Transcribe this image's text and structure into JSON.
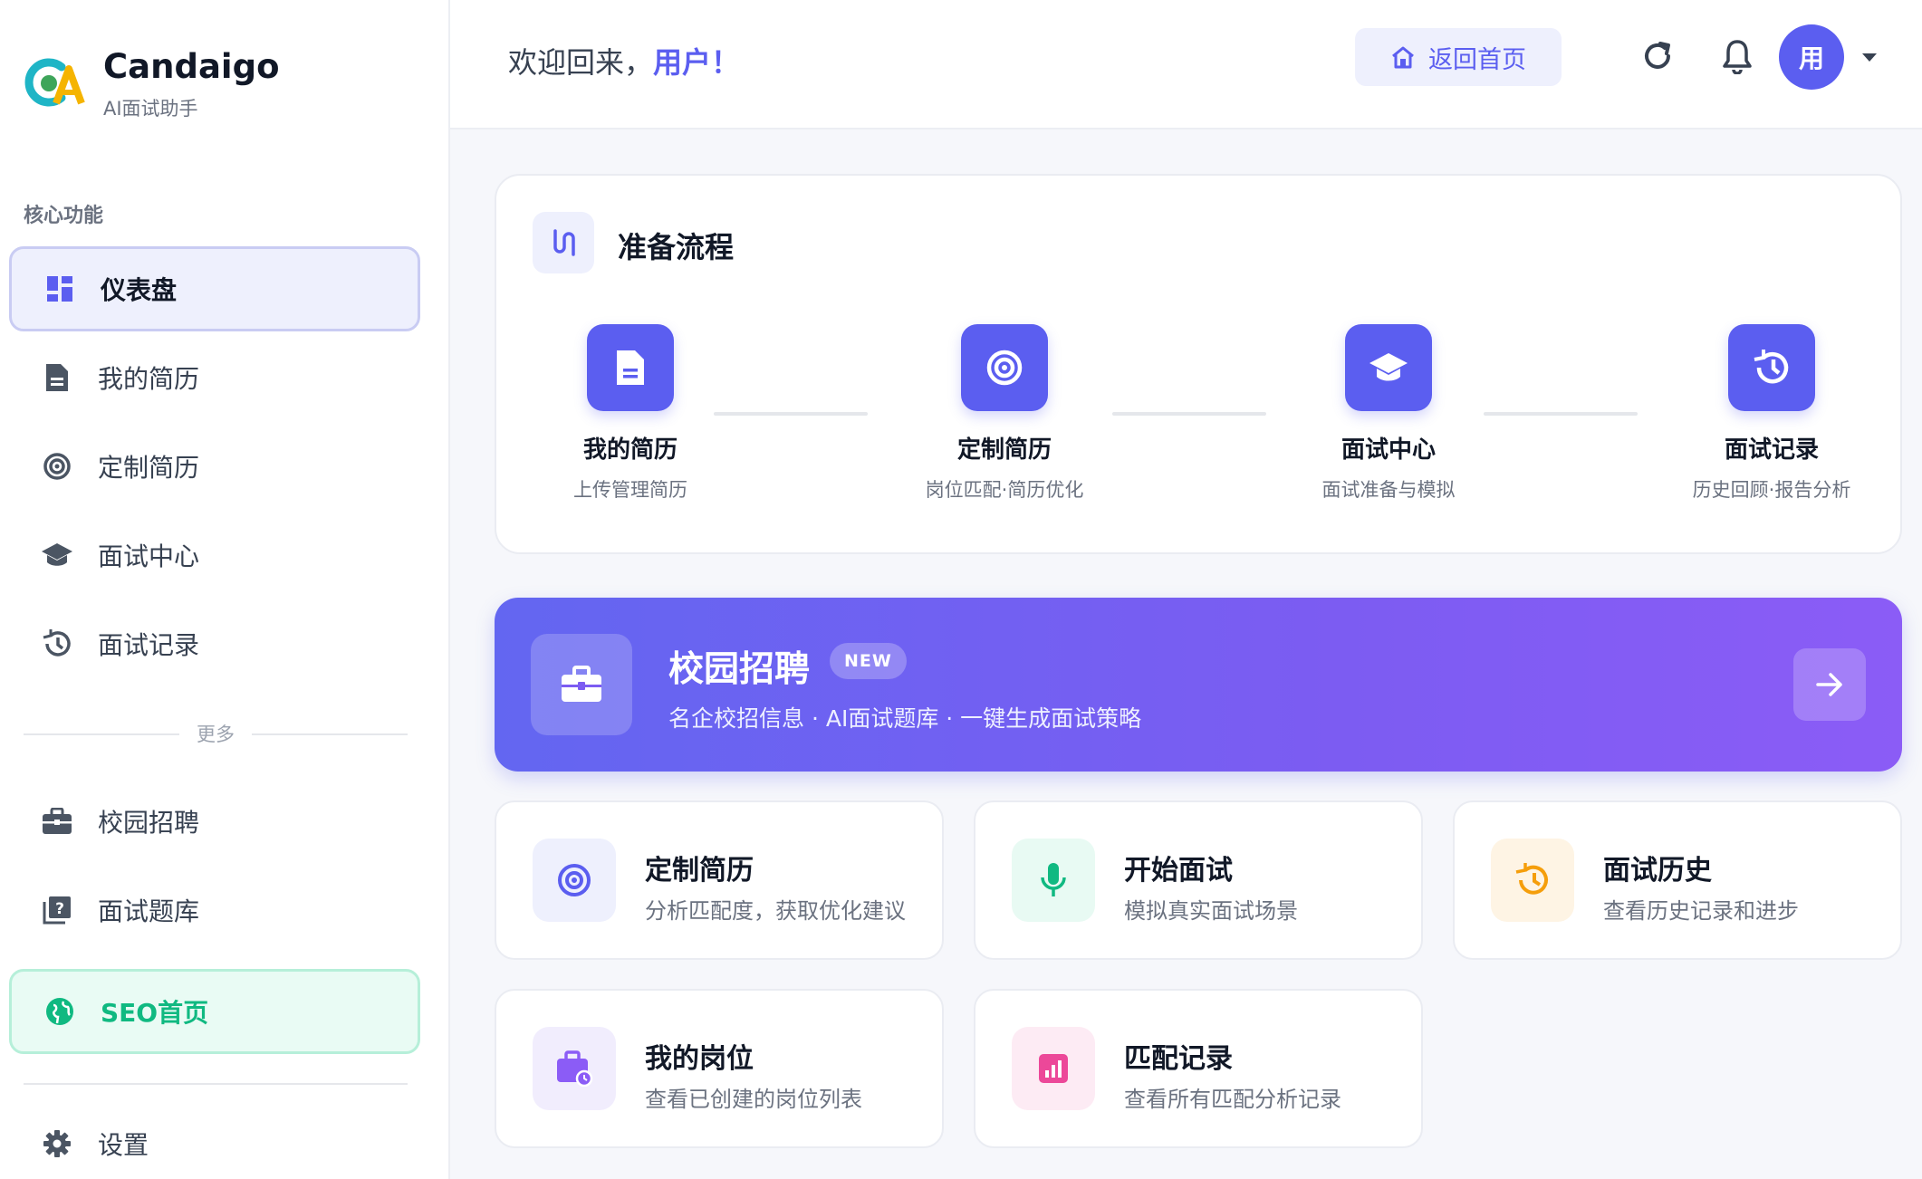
{
  "brand": {
    "name": "Candaigo",
    "subtitle": "AI面试助手"
  },
  "sidebar": {
    "section_core": "核心功能",
    "items": [
      {
        "label": "仪表盘",
        "icon": "dashboard-icon",
        "active": true
      },
      {
        "label": "我的简历",
        "icon": "document-icon"
      },
      {
        "label": "定制简历",
        "icon": "target-icon"
      },
      {
        "label": "面试中心",
        "icon": "graduation-cap-icon"
      },
      {
        "label": "面试记录",
        "icon": "history-icon"
      }
    ],
    "more_label": "更多",
    "more_items": [
      {
        "label": "校园招聘",
        "icon": "briefcase-icon"
      },
      {
        "label": "面试题库",
        "icon": "question-book-icon"
      },
      {
        "label": "SEO首页",
        "icon": "globe-icon",
        "highlight": true
      }
    ],
    "settings": {
      "label": "设置",
      "icon": "gear-icon"
    }
  },
  "header": {
    "welcome_prefix": "欢迎回来，",
    "welcome_user": "用户！",
    "home_button": "返回首页",
    "avatar_initial": "用"
  },
  "process": {
    "title": "准备流程",
    "steps": [
      {
        "title": "我的简历",
        "subtitle": "上传管理简历",
        "icon": "document-icon"
      },
      {
        "title": "定制简历",
        "subtitle": "岗位匹配·简历优化",
        "icon": "target-icon"
      },
      {
        "title": "面试中心",
        "subtitle": "面试准备与模拟",
        "icon": "graduation-cap-icon"
      },
      {
        "title": "面试记录",
        "subtitle": "历史回顾·报告分析",
        "icon": "history-icon"
      }
    ]
  },
  "banner": {
    "title": "校园招聘",
    "badge": "NEW",
    "subtitle": "名企校招信息 · AI面试题库 · 一键生成面试策略"
  },
  "quick_cards": [
    {
      "title": "定制简历",
      "subtitle": "分析匹配度，获取优化建议",
      "icon": "target-icon",
      "color": "#5b5ef0",
      "bg": "#eef0fd"
    },
    {
      "title": "开始面试",
      "subtitle": "模拟真实面试场景",
      "icon": "microphone-icon",
      "color": "#10b981",
      "bg": "#e8faf3"
    },
    {
      "title": "面试历史",
      "subtitle": "查看历史记录和进步",
      "icon": "history-icon",
      "color": "#f59e0b",
      "bg": "#fef4e4"
    },
    {
      "title": "我的岗位",
      "subtitle": "查看已创建的岗位列表",
      "icon": "job-briefcase-icon",
      "color": "#8b5cf6",
      "bg": "#f1edfd"
    },
    {
      "title": "匹配记录",
      "subtitle": "查看所有匹配分析记录",
      "icon": "chart-icon",
      "color": "#ec4899",
      "bg": "#fdebf4"
    }
  ],
  "colors": {
    "primary": "#5b5ef0",
    "success": "#10b981",
    "warning": "#f59e0b",
    "pink": "#ec4899"
  }
}
